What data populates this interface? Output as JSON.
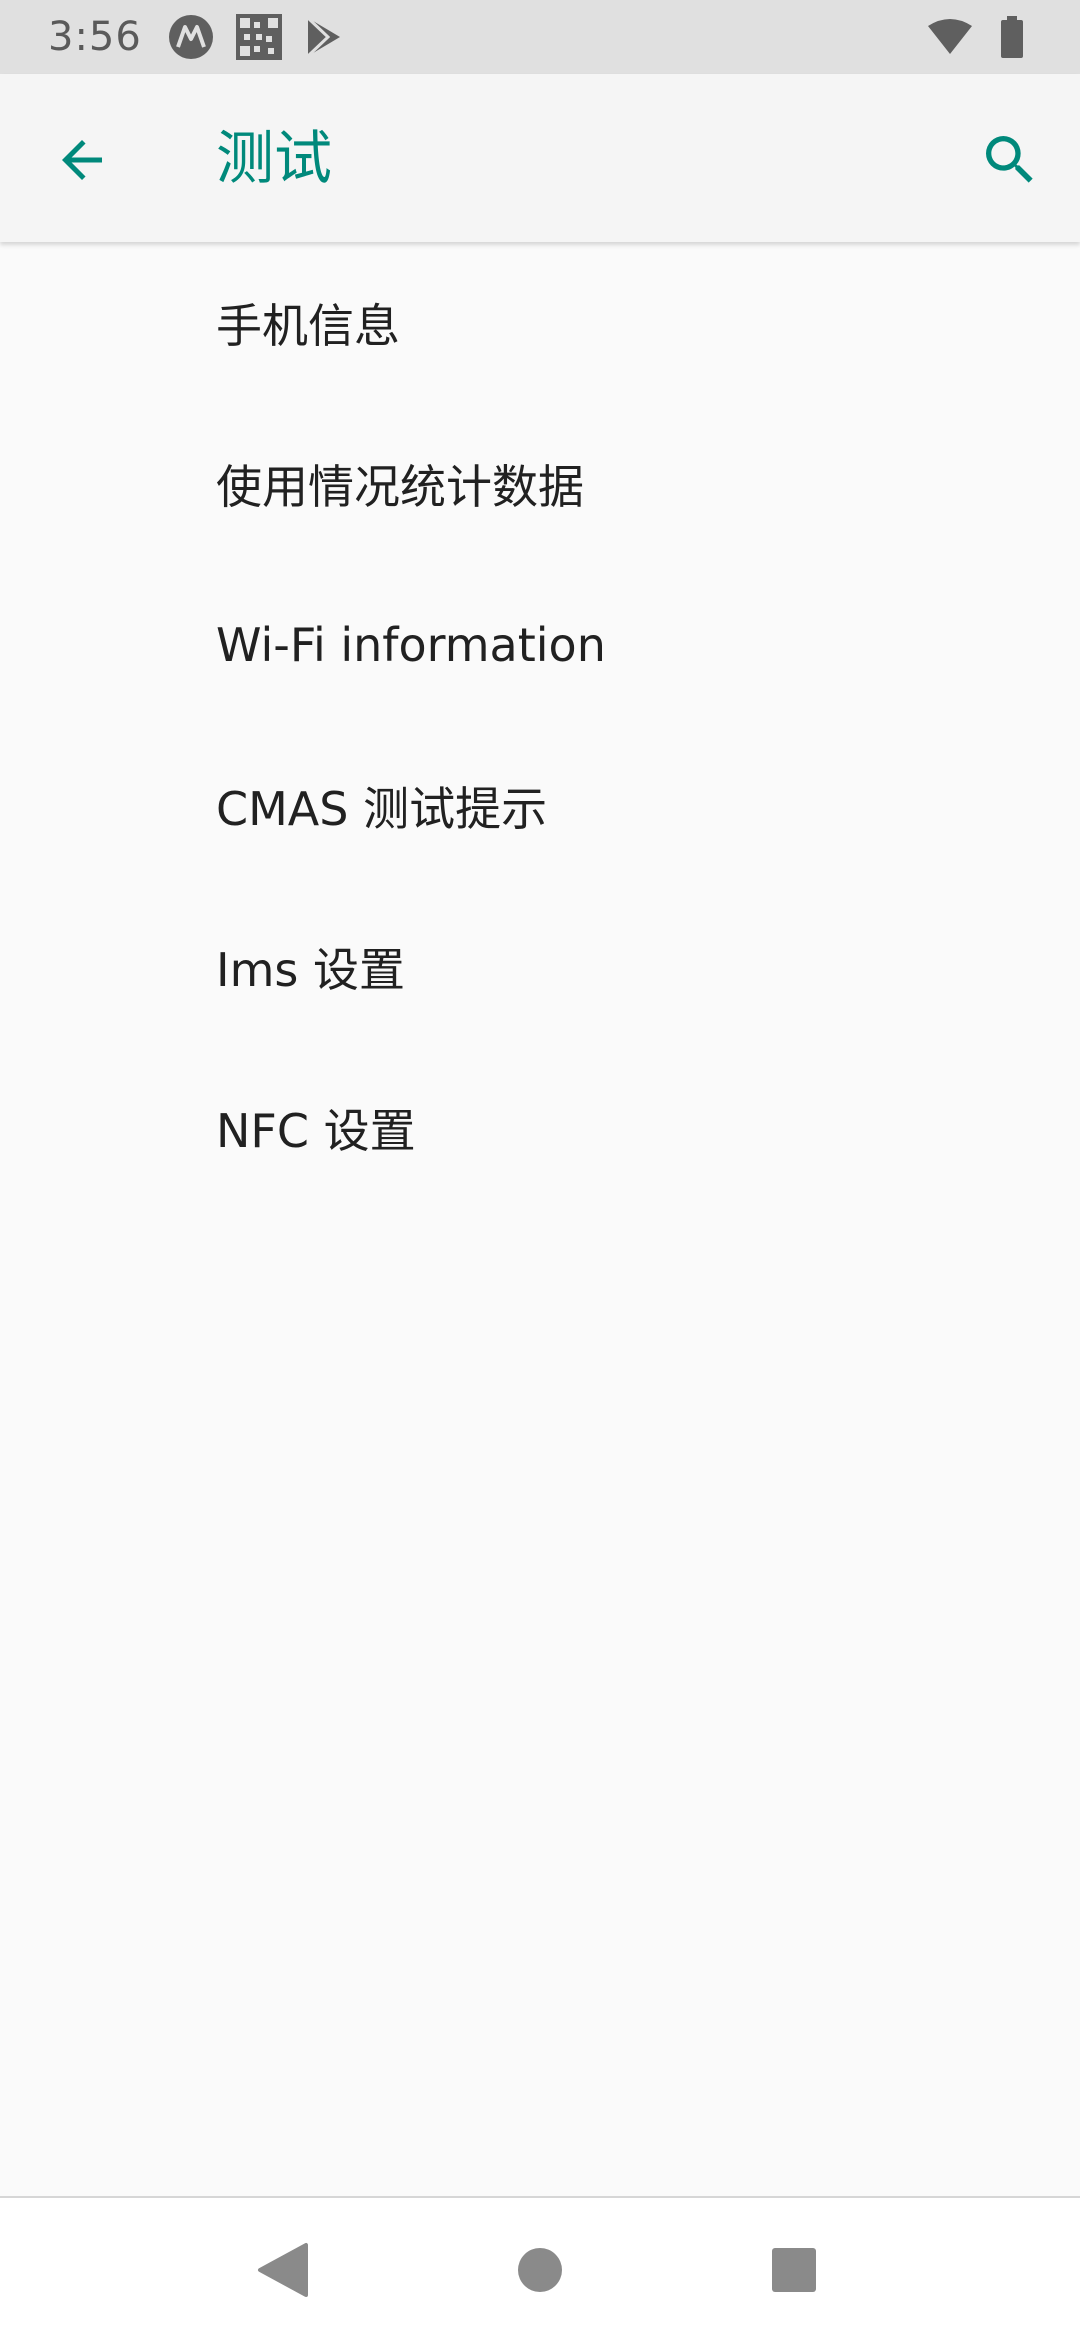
{
  "status_bar": {
    "time": "3:56",
    "icons_left": [
      "motorola-icon",
      "qr-code-icon",
      "play-store-icon"
    ],
    "icons_right": [
      "wifi-icon",
      "battery-icon"
    ]
  },
  "app_bar": {
    "title": "测试",
    "back_icon": "arrow-back-icon",
    "search_icon": "search-icon",
    "accent_color": "#00897b"
  },
  "list": {
    "items": [
      {
        "label": "手机信息"
      },
      {
        "label": "使用情况统计数据"
      },
      {
        "label": "Wi-Fi information"
      },
      {
        "label": "CMAS 测试提示"
      },
      {
        "label": "Ims 设置"
      },
      {
        "label": "NFC 设置"
      }
    ]
  },
  "nav_bar": {
    "buttons": [
      "nav-back-icon",
      "nav-home-icon",
      "nav-recents-icon"
    ]
  }
}
